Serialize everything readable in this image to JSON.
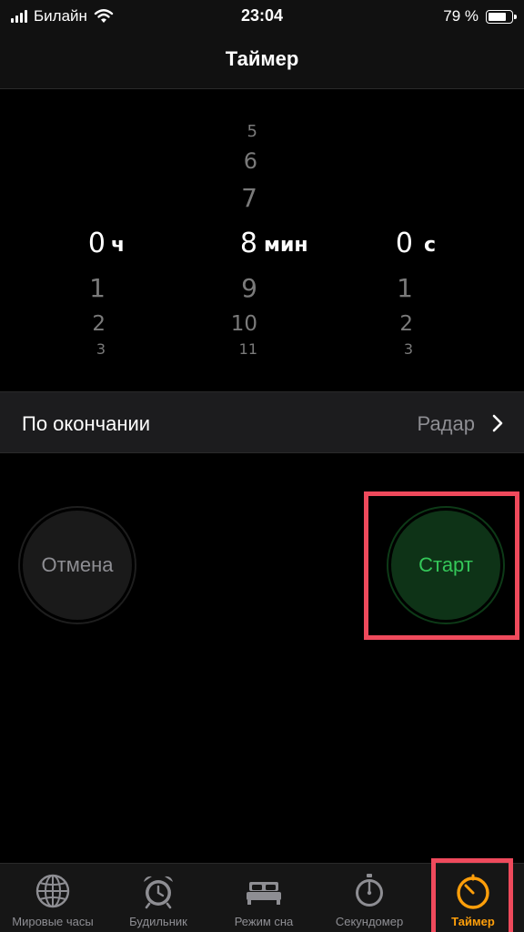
{
  "status_bar": {
    "carrier": "Билайн",
    "time": "23:04",
    "battery": "79 %",
    "battery_level": 0.79
  },
  "nav": {
    "title": "Таймер"
  },
  "picker": {
    "hours": {
      "above": [
        "",
        "",
        ""
      ],
      "selected": "0",
      "unit": "ч",
      "below": [
        "1",
        "2",
        "3"
      ]
    },
    "minutes": {
      "above": [
        "5",
        "6",
        "7"
      ],
      "selected": "8",
      "unit": "мин",
      "below": [
        "9",
        "10",
        "11"
      ]
    },
    "seconds": {
      "above": [
        "",
        "",
        ""
      ],
      "selected": "0",
      "unit": "с",
      "below": [
        "1",
        "2",
        "3"
      ]
    }
  },
  "after_timer": {
    "label": "По окончании",
    "value": "Радар"
  },
  "buttons": {
    "cancel": "Отмена",
    "start": "Старт"
  },
  "tabs": [
    {
      "label": "Мировые часы",
      "icon": "globe-icon"
    },
    {
      "label": "Будильник",
      "icon": "alarm-clock-icon"
    },
    {
      "label": "Режим сна",
      "icon": "bed-icon"
    },
    {
      "label": "Секундомер",
      "icon": "stopwatch-icon"
    },
    {
      "label": "Таймер",
      "icon": "timer-icon",
      "active": true
    }
  ],
  "colors": {
    "accent": "#ff9f0a",
    "start_green": "#34c759",
    "highlight": "#ef4a5c"
  }
}
